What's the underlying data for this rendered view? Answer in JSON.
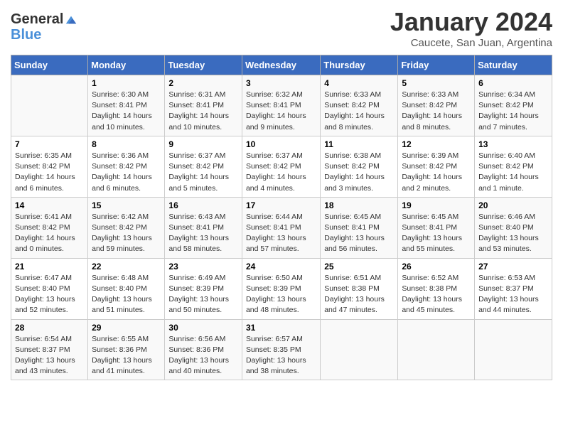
{
  "logo": {
    "general": "General",
    "blue": "Blue"
  },
  "title": "January 2024",
  "subtitle": "Caucete, San Juan, Argentina",
  "days_of_week": [
    "Sunday",
    "Monday",
    "Tuesday",
    "Wednesday",
    "Thursday",
    "Friday",
    "Saturday"
  ],
  "weeks": [
    [
      {
        "num": "",
        "sunrise": "",
        "sunset": "",
        "daylight": ""
      },
      {
        "num": "1",
        "sunrise": "Sunrise: 6:30 AM",
        "sunset": "Sunset: 8:41 PM",
        "daylight": "Daylight: 14 hours and 10 minutes."
      },
      {
        "num": "2",
        "sunrise": "Sunrise: 6:31 AM",
        "sunset": "Sunset: 8:41 PM",
        "daylight": "Daylight: 14 hours and 10 minutes."
      },
      {
        "num": "3",
        "sunrise": "Sunrise: 6:32 AM",
        "sunset": "Sunset: 8:41 PM",
        "daylight": "Daylight: 14 hours and 9 minutes."
      },
      {
        "num": "4",
        "sunrise": "Sunrise: 6:33 AM",
        "sunset": "Sunset: 8:42 PM",
        "daylight": "Daylight: 14 hours and 8 minutes."
      },
      {
        "num": "5",
        "sunrise": "Sunrise: 6:33 AM",
        "sunset": "Sunset: 8:42 PM",
        "daylight": "Daylight: 14 hours and 8 minutes."
      },
      {
        "num": "6",
        "sunrise": "Sunrise: 6:34 AM",
        "sunset": "Sunset: 8:42 PM",
        "daylight": "Daylight: 14 hours and 7 minutes."
      }
    ],
    [
      {
        "num": "7",
        "sunrise": "Sunrise: 6:35 AM",
        "sunset": "Sunset: 8:42 PM",
        "daylight": "Daylight: 14 hours and 6 minutes."
      },
      {
        "num": "8",
        "sunrise": "Sunrise: 6:36 AM",
        "sunset": "Sunset: 8:42 PM",
        "daylight": "Daylight: 14 hours and 6 minutes."
      },
      {
        "num": "9",
        "sunrise": "Sunrise: 6:37 AM",
        "sunset": "Sunset: 8:42 PM",
        "daylight": "Daylight: 14 hours and 5 minutes."
      },
      {
        "num": "10",
        "sunrise": "Sunrise: 6:37 AM",
        "sunset": "Sunset: 8:42 PM",
        "daylight": "Daylight: 14 hours and 4 minutes."
      },
      {
        "num": "11",
        "sunrise": "Sunrise: 6:38 AM",
        "sunset": "Sunset: 8:42 PM",
        "daylight": "Daylight: 14 hours and 3 minutes."
      },
      {
        "num": "12",
        "sunrise": "Sunrise: 6:39 AM",
        "sunset": "Sunset: 8:42 PM",
        "daylight": "Daylight: 14 hours and 2 minutes."
      },
      {
        "num": "13",
        "sunrise": "Sunrise: 6:40 AM",
        "sunset": "Sunset: 8:42 PM",
        "daylight": "Daylight: 14 hours and 1 minute."
      }
    ],
    [
      {
        "num": "14",
        "sunrise": "Sunrise: 6:41 AM",
        "sunset": "Sunset: 8:42 PM",
        "daylight": "Daylight: 14 hours and 0 minutes."
      },
      {
        "num": "15",
        "sunrise": "Sunrise: 6:42 AM",
        "sunset": "Sunset: 8:42 PM",
        "daylight": "Daylight: 13 hours and 59 minutes."
      },
      {
        "num": "16",
        "sunrise": "Sunrise: 6:43 AM",
        "sunset": "Sunset: 8:41 PM",
        "daylight": "Daylight: 13 hours and 58 minutes."
      },
      {
        "num": "17",
        "sunrise": "Sunrise: 6:44 AM",
        "sunset": "Sunset: 8:41 PM",
        "daylight": "Daylight: 13 hours and 57 minutes."
      },
      {
        "num": "18",
        "sunrise": "Sunrise: 6:45 AM",
        "sunset": "Sunset: 8:41 PM",
        "daylight": "Daylight: 13 hours and 56 minutes."
      },
      {
        "num": "19",
        "sunrise": "Sunrise: 6:45 AM",
        "sunset": "Sunset: 8:41 PM",
        "daylight": "Daylight: 13 hours and 55 minutes."
      },
      {
        "num": "20",
        "sunrise": "Sunrise: 6:46 AM",
        "sunset": "Sunset: 8:40 PM",
        "daylight": "Daylight: 13 hours and 53 minutes."
      }
    ],
    [
      {
        "num": "21",
        "sunrise": "Sunrise: 6:47 AM",
        "sunset": "Sunset: 8:40 PM",
        "daylight": "Daylight: 13 hours and 52 minutes."
      },
      {
        "num": "22",
        "sunrise": "Sunrise: 6:48 AM",
        "sunset": "Sunset: 8:40 PM",
        "daylight": "Daylight: 13 hours and 51 minutes."
      },
      {
        "num": "23",
        "sunrise": "Sunrise: 6:49 AM",
        "sunset": "Sunset: 8:39 PM",
        "daylight": "Daylight: 13 hours and 50 minutes."
      },
      {
        "num": "24",
        "sunrise": "Sunrise: 6:50 AM",
        "sunset": "Sunset: 8:39 PM",
        "daylight": "Daylight: 13 hours and 48 minutes."
      },
      {
        "num": "25",
        "sunrise": "Sunrise: 6:51 AM",
        "sunset": "Sunset: 8:38 PM",
        "daylight": "Daylight: 13 hours and 47 minutes."
      },
      {
        "num": "26",
        "sunrise": "Sunrise: 6:52 AM",
        "sunset": "Sunset: 8:38 PM",
        "daylight": "Daylight: 13 hours and 45 minutes."
      },
      {
        "num": "27",
        "sunrise": "Sunrise: 6:53 AM",
        "sunset": "Sunset: 8:37 PM",
        "daylight": "Daylight: 13 hours and 44 minutes."
      }
    ],
    [
      {
        "num": "28",
        "sunrise": "Sunrise: 6:54 AM",
        "sunset": "Sunset: 8:37 PM",
        "daylight": "Daylight: 13 hours and 43 minutes."
      },
      {
        "num": "29",
        "sunrise": "Sunrise: 6:55 AM",
        "sunset": "Sunset: 8:36 PM",
        "daylight": "Daylight: 13 hours and 41 minutes."
      },
      {
        "num": "30",
        "sunrise": "Sunrise: 6:56 AM",
        "sunset": "Sunset: 8:36 PM",
        "daylight": "Daylight: 13 hours and 40 minutes."
      },
      {
        "num": "31",
        "sunrise": "Sunrise: 6:57 AM",
        "sunset": "Sunset: 8:35 PM",
        "daylight": "Daylight: 13 hours and 38 minutes."
      },
      {
        "num": "",
        "sunrise": "",
        "sunset": "",
        "daylight": ""
      },
      {
        "num": "",
        "sunrise": "",
        "sunset": "",
        "daylight": ""
      },
      {
        "num": "",
        "sunrise": "",
        "sunset": "",
        "daylight": ""
      }
    ]
  ]
}
